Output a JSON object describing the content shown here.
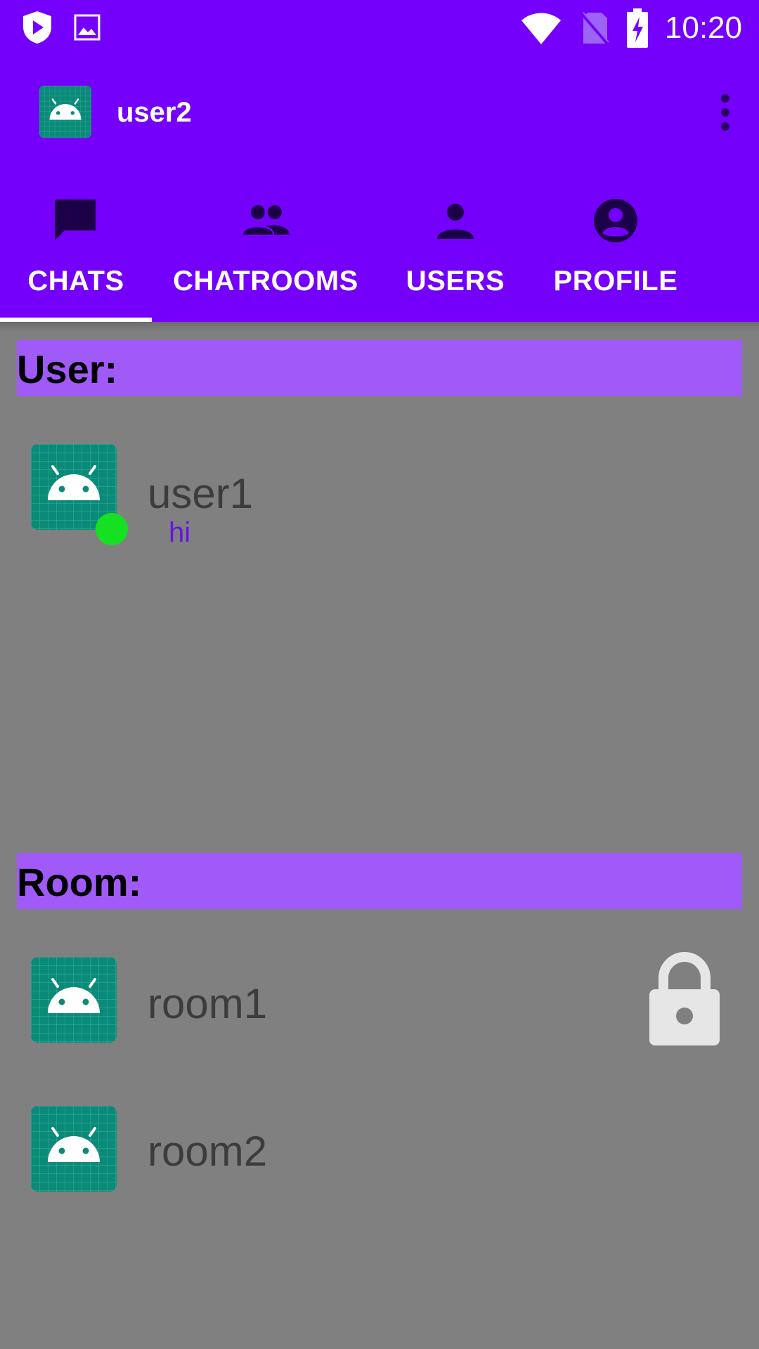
{
  "status_bar": {
    "time": "10:20",
    "icons": [
      "shield-play-icon",
      "image-icon",
      "wifi-icon",
      "no-sim-icon",
      "battery-charging-icon"
    ]
  },
  "app_bar": {
    "title": "user2",
    "menu_icon": "more-vert-icon"
  },
  "tabs": [
    {
      "label": "CHATS",
      "icon": "chat-icon",
      "selected": true
    },
    {
      "label": "CHATROOMS",
      "icon": "group-icon",
      "selected": false
    },
    {
      "label": "USERS",
      "icon": "person-icon",
      "selected": false
    },
    {
      "label": "PROFILE",
      "icon": "account-circle-icon",
      "selected": false
    }
  ],
  "sections": {
    "user_header": "User:",
    "room_header": "Room:"
  },
  "user_chats": [
    {
      "name": "user1",
      "last_message": "hi",
      "online": true
    }
  ],
  "rooms": [
    {
      "name": "room1",
      "locked": true
    },
    {
      "name": "room2",
      "locked": false
    }
  ],
  "colors": {
    "primary": "#7400fc",
    "section_header": "#a05af8",
    "background": "#808080",
    "online": "#15e021",
    "message": "#6a13e8"
  }
}
